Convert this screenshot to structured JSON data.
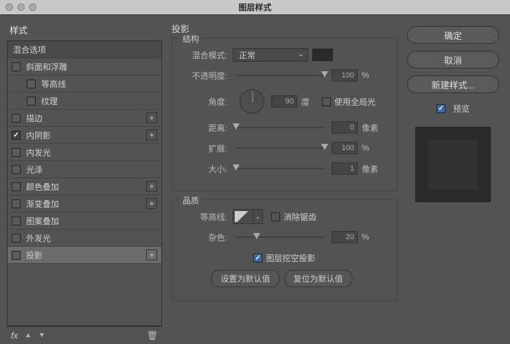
{
  "title": "图层样式",
  "sidebar": {
    "styles_label": "样式",
    "blend_options_label": "混合选项",
    "items": [
      {
        "label": "斜面和浮雕",
        "checked": false,
        "plus": false
      },
      {
        "label": "等高线",
        "checked": false,
        "indent": true,
        "plus": false
      },
      {
        "label": "纹理",
        "checked": false,
        "indent": true,
        "plus": false
      },
      {
        "label": "描边",
        "checked": false,
        "plus": true
      },
      {
        "label": "内阴影",
        "checked": true,
        "plus": true
      },
      {
        "label": "内发光",
        "checked": false,
        "plus": false
      },
      {
        "label": "光泽",
        "checked": false,
        "plus": false
      },
      {
        "label": "颜色叠加",
        "checked": false,
        "plus": true
      },
      {
        "label": "渐变叠加",
        "checked": false,
        "plus": true
      },
      {
        "label": "图案叠加",
        "checked": false,
        "plus": false
      },
      {
        "label": "外发光",
        "checked": false,
        "plus": false
      },
      {
        "label": "投影",
        "checked": false,
        "plus": true,
        "selected": true
      }
    ],
    "fx_label": "fx"
  },
  "center": {
    "panel_title": "投影",
    "structure": {
      "group_label": "结构",
      "blend_mode_label": "混合模式:",
      "blend_mode_value": "正常",
      "opacity_label": "不透明度:",
      "opacity_value": "100",
      "opacity_unit": "%",
      "angle_label": "角度:",
      "angle_value": "90",
      "angle_unit": "度",
      "global_light_label": "使用全局光",
      "distance_label": "距离:",
      "distance_value": "0",
      "distance_unit": "像素",
      "spread_label": "扩展:",
      "spread_value": "100",
      "spread_unit": "%",
      "size_label": "大小:",
      "size_value": "1",
      "size_unit": "像素"
    },
    "quality": {
      "group_label": "品质",
      "contour_label": "等高线:",
      "antialias_label": "消除锯齿",
      "noise_label": "杂色:",
      "noise_value": "20",
      "noise_unit": "%",
      "knockout_label": "图层挖空投影",
      "set_default": "设置为默认值",
      "reset_default": "复位为默认值"
    }
  },
  "right": {
    "ok": "确定",
    "cancel": "取消",
    "new_style": "新建样式...",
    "preview_label": "预览"
  }
}
